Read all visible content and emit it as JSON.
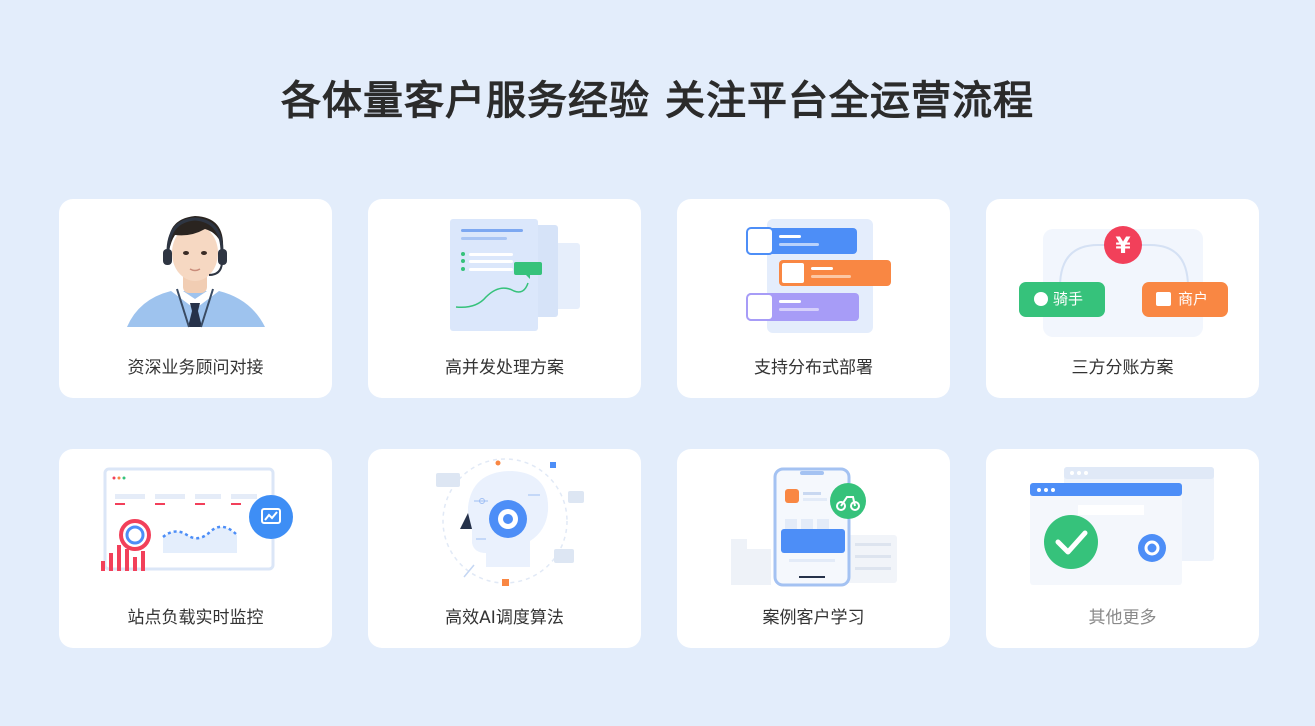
{
  "page": {
    "title": "各体量客户服务经验 关注平台全运营流程"
  },
  "cards": [
    {
      "label": "资深业务顾问对接",
      "icon": "consultant-avatar-icon"
    },
    {
      "label": "高并发处理方案",
      "icon": "document-chart-icon"
    },
    {
      "label": "支持分布式部署",
      "icon": "distributed-list-icon"
    },
    {
      "label": "三方分账方案",
      "icon": "split-payment-icon",
      "tags": [
        "骑手",
        "商户"
      ],
      "currency_symbol": "¥"
    },
    {
      "label": "站点负载实时监控",
      "icon": "monitor-dashboard-icon"
    },
    {
      "label": "高效AI调度算法",
      "icon": "ai-head-gear-icon"
    },
    {
      "label": "案例客户学习",
      "icon": "phone-delivery-icon"
    },
    {
      "label": "其他更多",
      "icon": "more-browser-check-icon"
    }
  ],
  "colors": {
    "background": "#e3edfb",
    "title": "#2b2b2b",
    "blue": "#4d8ef7",
    "orange": "#f98743",
    "green": "#36c27b",
    "purple": "#a79cf7",
    "red": "#f2405a"
  }
}
